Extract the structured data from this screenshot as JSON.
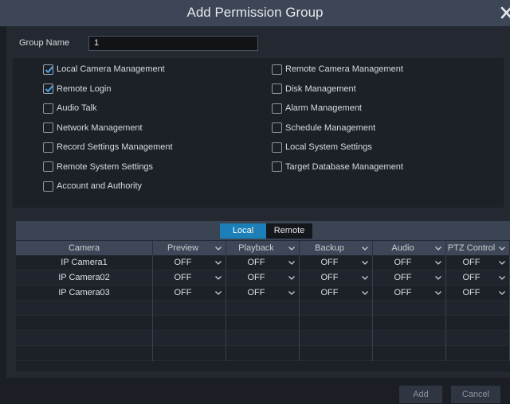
{
  "dialog": {
    "title": "Add Permission Group"
  },
  "group": {
    "label": "Group Name",
    "value": "1"
  },
  "permissions": {
    "left": [
      {
        "label": "Local Camera Management",
        "checked": true
      },
      {
        "label": "Remote Login",
        "checked": true
      },
      {
        "label": "Audio Talk",
        "checked": false
      },
      {
        "label": "Network Management",
        "checked": false
      },
      {
        "label": "Record Settings Management",
        "checked": false
      },
      {
        "label": "Remote System Settings",
        "checked": false
      },
      {
        "label": "Account and Authority",
        "checked": false
      }
    ],
    "right": [
      {
        "label": "Remote Camera Management",
        "checked": false
      },
      {
        "label": "Disk Management",
        "checked": false
      },
      {
        "label": "Alarm Management",
        "checked": false
      },
      {
        "label": "Schedule Management",
        "checked": false
      },
      {
        "label": "Local System Settings",
        "checked": false
      },
      {
        "label": "Target Database Management",
        "checked": false
      }
    ]
  },
  "tabs": {
    "local": "Local",
    "remote": "Remote",
    "active": "local"
  },
  "table": {
    "headers": [
      "Camera",
      "Preview",
      "Playback",
      "Backup",
      "Audio",
      "PTZ Control"
    ],
    "rows": [
      {
        "camera": "IP Camera1",
        "values": [
          "OFF",
          "OFF",
          "OFF",
          "OFF",
          "OFF"
        ]
      },
      {
        "camera": "IP Camera02",
        "values": [
          "OFF",
          "OFF",
          "OFF",
          "OFF",
          "OFF"
        ]
      },
      {
        "camera": "IP Camera03",
        "values": [
          "OFF",
          "OFF",
          "OFF",
          "OFF",
          "OFF"
        ]
      }
    ]
  },
  "buttons": {
    "add": "Add",
    "cancel": "Cancel"
  },
  "colors": {
    "accent": "#1d7fb7",
    "titlebar": "#3c4656",
    "background": "#1b1e24"
  }
}
